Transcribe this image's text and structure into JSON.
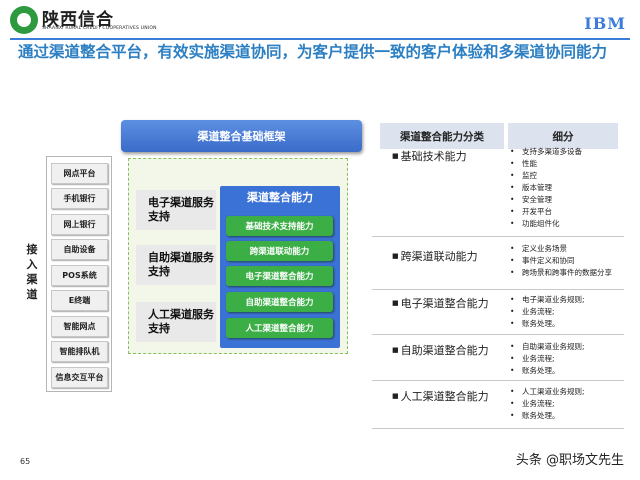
{
  "header": {
    "logo_cn": "陕西信合",
    "logo_en_line1": "SHAANXI RURAL CREDIT COOPERATIVES UNION",
    "logo_en_line2": "",
    "ibm": "IBM",
    "title": "通过渠道整合平台，有效实施渠道协同，为客户提供一致的客户体验和多渠道协同能力"
  },
  "framework": {
    "header": "渠道整合基础框架",
    "side_label": "接入渠道",
    "channels": [
      "网点平台",
      "手机银行",
      "网上银行",
      "自助设备",
      "POS系统",
      "E终端",
      "智能网点",
      "智能排队机",
      "信息交互平台"
    ],
    "services": [
      "电子渠道服务支持",
      "自助渠道服务支持",
      "人工渠道服务支持"
    ],
    "capability_title": "渠道整合能力",
    "capabilities": [
      "基础技术支持能力",
      "跨渠道联动能力",
      "电子渠道整合能力",
      "自助渠道整合能力",
      "人工渠道整合能力"
    ]
  },
  "table": {
    "col1": "渠道整合能力分类",
    "col2": "细分",
    "rows": [
      {
        "category": "基础技术能力",
        "details": [
          "支持多渠道多设备",
          "性能",
          "监控",
          "版本管理",
          "安全管理",
          "开发平台",
          "功能组件化"
        ]
      },
      {
        "category": "跨渠道联动能力",
        "details": [
          "定义业务场景",
          "事件定义和协同",
          "跨场景和跨事件的数据分享"
        ]
      },
      {
        "category": "电子渠道整合能力",
        "details": [
          "电子渠道业务规则;",
          "业务流程;",
          "账务处理。"
        ]
      },
      {
        "category": "自助渠道整合能力",
        "details": [
          "自助渠道业务规则;",
          "业务流程;",
          "账务处理。"
        ]
      },
      {
        "category": "人工渠道整合能力",
        "details": [
          "人工渠道业务规则;",
          "业务流程;",
          "账务处理。"
        ]
      }
    ]
  },
  "footer": {
    "page_number": "65",
    "watermark": "头条 @职场文先生"
  },
  "colors": {
    "title_blue": "#2c7fc2",
    "capability_blue": "#3b72d6",
    "capability_green": "#3cae46"
  }
}
